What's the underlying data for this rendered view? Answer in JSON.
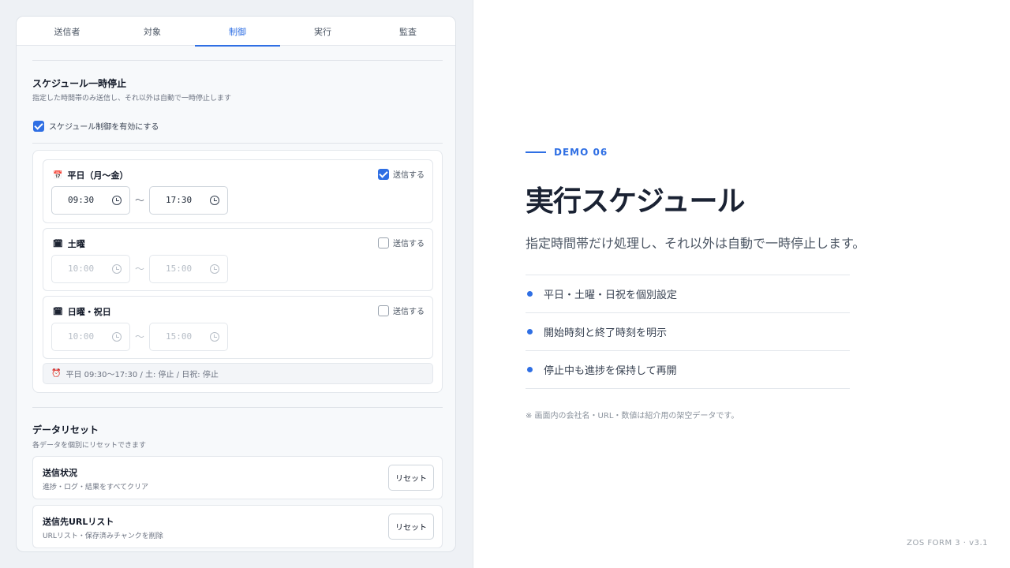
{
  "tabs": [
    {
      "label": "送信者"
    },
    {
      "label": "対象"
    },
    {
      "label": "制御"
    },
    {
      "label": "実行"
    },
    {
      "label": "監査"
    }
  ],
  "active_tab": "制御",
  "schedule": {
    "title": "スケジュール一時停止",
    "subtitle": "指定した時間帯のみ送信し、それ以外は自動で一時停止します",
    "enable_label": "スケジュール制御を有効にする",
    "enabled": true,
    "days": [
      {
        "label": "平日（月〜金）",
        "icon": "calendar-icon",
        "send_label": "送信する",
        "send": true,
        "start": "09:30",
        "end": "17:30"
      },
      {
        "label": "土曜",
        "icon": "calendar-one-icon",
        "send_label": "送信する",
        "send": false,
        "start": "10:00",
        "end": "15:00"
      },
      {
        "label": "日曜・祝日",
        "icon": "calendar-one-icon",
        "send_label": "送信する",
        "send": false,
        "start": "10:00",
        "end": "15:00"
      }
    ],
    "separator": "〜",
    "summary_icon": "alarm-clock-icon",
    "summary": "平日 09:30〜17:30 / 土: 停止 / 日祝: 停止"
  },
  "reset": {
    "title": "データリセット",
    "subtitle": "各データを個別にリセットできます",
    "items": [
      {
        "title": "送信状況",
        "desc": "進捗・ログ・結果をすべてクリア",
        "button": "リセット"
      },
      {
        "title": "送信先URLリスト",
        "desc": "URLリスト・保存済みチャンクを削除",
        "button": "リセット"
      }
    ]
  },
  "hero": {
    "eyebrow": "DEMO 06",
    "title": "実行スケジュール",
    "lead": "指定時間帯だけ処理し、それ以外は自動で一時停止します。",
    "features": [
      "平日・土曜・日祝を個別設定",
      "開始時刻と終了時刻を明示",
      "停止中も進捗を保持して再開"
    ],
    "note": "※ 画面内の会社名・URL・数値は紹介用の架空データです。"
  },
  "version": "ZOS FORM 3 · v3.1",
  "colors": {
    "accent": "#2f6fe4",
    "heading": "#1a2233"
  }
}
